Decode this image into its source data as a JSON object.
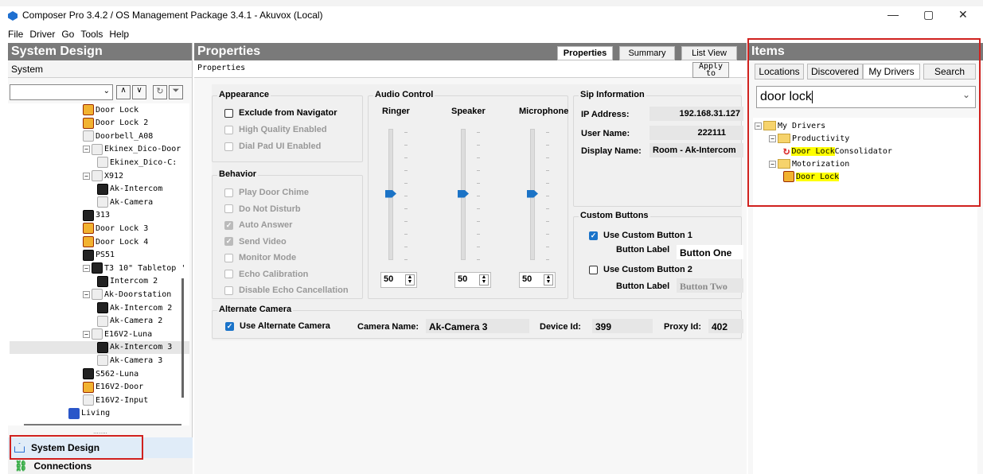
{
  "window": {
    "title": "Composer Pro 3.4.2 / OS Management Package 3.4.1 - Akuvox (Local)",
    "minimize": "—",
    "restore": "▢",
    "close": "✕"
  },
  "menu": [
    "File",
    "Driver",
    "Go",
    "Tools",
    "Help"
  ],
  "left": {
    "header": "System Design",
    "subheader": "System",
    "tree": [
      {
        "label": "Door Lock",
        "icon": "lock-icon",
        "depth": 5
      },
      {
        "label": "Door Lock 2",
        "icon": "lock-icon",
        "depth": 5
      },
      {
        "label": "Doorbell_A08",
        "icon": "camera-icon",
        "depth": 5
      },
      {
        "label": "Ekinex_Dico-Door",
        "icon": "camera-icon",
        "depth": 5,
        "exp": "−"
      },
      {
        "label": "Ekinex_Dico-C:",
        "icon": "camera-icon",
        "depth": 6
      },
      {
        "label": "X912",
        "icon": "camera-icon",
        "depth": 5,
        "exp": "−"
      },
      {
        "label": "Ak-Intercom",
        "icon": "device-icon",
        "depth": 6
      },
      {
        "label": "Ak-Camera",
        "icon": "camera-icon",
        "depth": 6
      },
      {
        "label": "313",
        "icon": "device-icon",
        "depth": 5
      },
      {
        "label": "Door Lock 3",
        "icon": "lock-icon",
        "depth": 5
      },
      {
        "label": "Door Lock 4",
        "icon": "lock-icon",
        "depth": 5
      },
      {
        "label": "PS51",
        "icon": "device-icon",
        "depth": 5
      },
      {
        "label": "T3 10\" Tabletop '",
        "icon": "device-icon",
        "depth": 5,
        "exp": "−"
      },
      {
        "label": "Intercom 2",
        "icon": "device-icon",
        "depth": 6
      },
      {
        "label": "Ak-Doorstation",
        "icon": "camera-icon",
        "depth": 5,
        "exp": "−"
      },
      {
        "label": "Ak-Intercom 2",
        "icon": "device-icon",
        "depth": 6
      },
      {
        "label": "Ak-Camera 2",
        "icon": "camera-icon",
        "depth": 6
      },
      {
        "label": "E16V2-Luna",
        "icon": "camera-icon",
        "depth": 5,
        "exp": "−"
      },
      {
        "label": "Ak-Intercom 3",
        "icon": "device-icon",
        "depth": 6,
        "selected": true
      },
      {
        "label": "Ak-Camera 3",
        "icon": "camera-icon",
        "depth": 6
      },
      {
        "label": "S562-Luna",
        "icon": "device-icon",
        "depth": 5
      },
      {
        "label": "E16V2-Door",
        "icon": "lock-icon",
        "depth": 5
      },
      {
        "label": "E16V2-Input",
        "icon": "camera-icon",
        "depth": 5
      },
      {
        "label": "Living",
        "icon": "room-icon",
        "depth": 4
      }
    ],
    "nav": [
      {
        "label": "System Design",
        "icon": "home-icon"
      },
      {
        "label": "Connections",
        "icon": "link-icon"
      }
    ]
  },
  "center": {
    "header": "Properties",
    "tabs": [
      "Properties",
      "Summary",
      "List View"
    ],
    "subheader": "Properties",
    "apply": "Apply to",
    "appearance": {
      "title": "Appearance",
      "items": [
        {
          "label": "Exclude from Navigator",
          "checked": false,
          "disabled": false
        },
        {
          "label": "High Quality Enabled",
          "checked": false,
          "disabled": true
        },
        {
          "label": "Dial Pad UI Enabled",
          "checked": false,
          "disabled": true
        }
      ]
    },
    "behavior": {
      "title": "Behavior",
      "items": [
        {
          "label": "Play Door Chime",
          "checked": false,
          "disabled": true
        },
        {
          "label": "Do Not Disturb",
          "checked": false,
          "disabled": true
        },
        {
          "label": "Auto Answer",
          "checked": true,
          "disabled": true
        },
        {
          "label": "Send Video",
          "checked": true,
          "disabled": true
        },
        {
          "label": "Monitor Mode",
          "checked": false,
          "disabled": true
        },
        {
          "label": "Echo Calibration",
          "checked": false,
          "disabled": true
        },
        {
          "label": "Disable Echo Cancellation",
          "checked": false,
          "disabled": true
        }
      ]
    },
    "audio": {
      "title": "Audio Control",
      "channels": [
        {
          "label": "Ringer",
          "value": "50",
          "level": 0.5
        },
        {
          "label": "Speaker",
          "value": "50",
          "level": 0.5
        },
        {
          "label": "Microphone",
          "value": "50",
          "level": 0.5
        }
      ]
    },
    "sip": {
      "title": "Sip Information",
      "fields": [
        {
          "label": "IP Address:",
          "value": "192.168.31.127"
        },
        {
          "label": "User Name:",
          "value": "222111"
        },
        {
          "label": "Display Name:",
          "value": "Room - Ak-Intercom"
        }
      ]
    },
    "custom": {
      "title": "Custom Buttons",
      "b1": {
        "label": "Use Custom Button 1",
        "checked": true,
        "field": "Button Label",
        "value": "Button One"
      },
      "b2": {
        "label": "Use Custom Button 2",
        "checked": false,
        "field": "Button Label",
        "value": "Button Two"
      }
    },
    "alt": {
      "title": "Alternate Camera",
      "use": "Use Alternate Camera",
      "cam_label": "Camera Name:",
      "cam": "Ak-Camera 3",
      "dev_label": "Device Id:",
      "dev": "399",
      "proxy_label": "Proxy Id:",
      "proxy": "402"
    }
  },
  "right": {
    "header": "Items",
    "tabs": [
      "Locations",
      "Discovered",
      "My Drivers",
      "Search"
    ],
    "search": "door lock",
    "tree": [
      {
        "label": "My Drivers",
        "type": "folder"
      },
      {
        "label": "Productivity",
        "type": "folder"
      },
      {
        "match": "Door Lock",
        "rest": " Consolidator",
        "type": "driver"
      },
      {
        "label": "Motorization",
        "type": "folder"
      },
      {
        "match": "Door Lock",
        "rest": "",
        "type": "lock"
      }
    ]
  }
}
